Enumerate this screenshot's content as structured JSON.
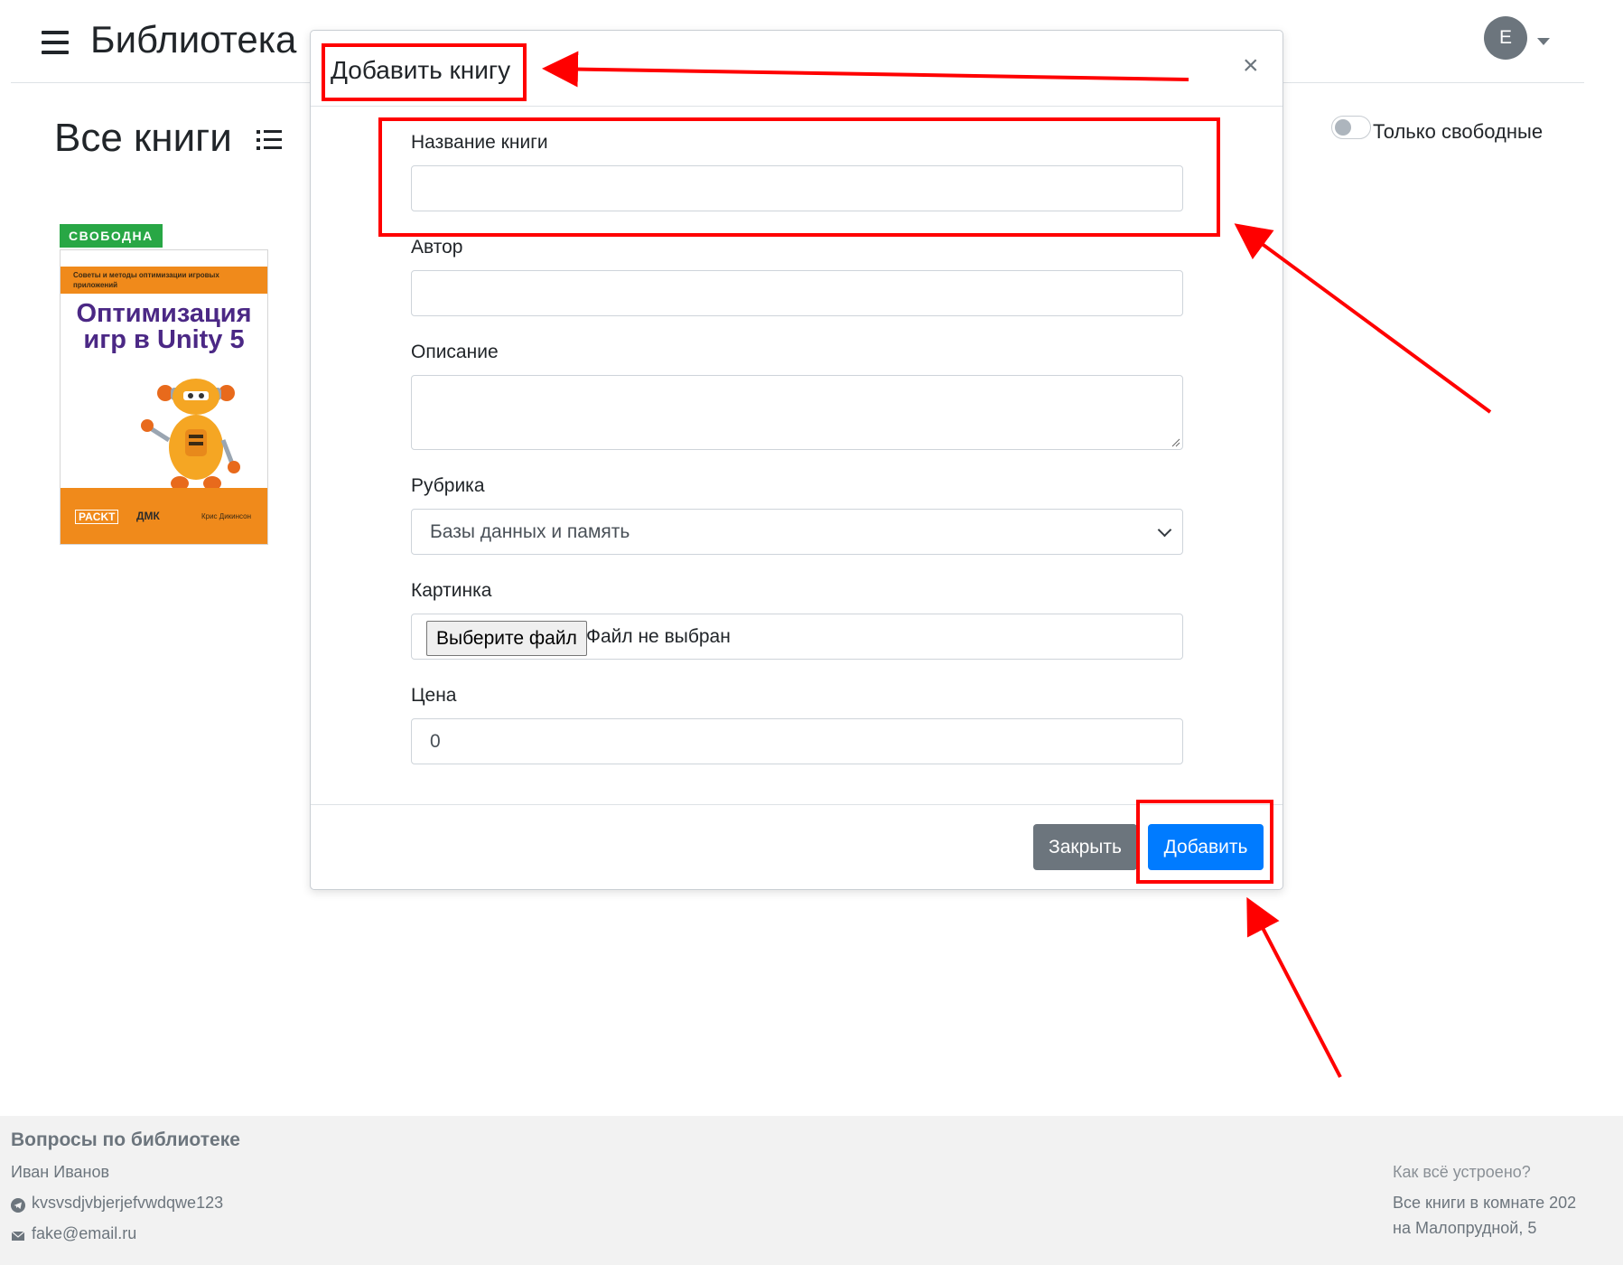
{
  "header": {
    "app_title": "Библиотека",
    "avatar_initial": "E"
  },
  "subheader": {
    "page_heading": "Все книги",
    "toggle_label": "Только свободные"
  },
  "book": {
    "badge": "СВОБОДНА",
    "cover_tagline": "Советы и методы оптимизации игровых приложений",
    "cover_title": "Оптимизация игр в Unity 5",
    "cover_publisher_1": "PACKT",
    "cover_publisher_2": "ДМК",
    "cover_author": "Крис Дикинсон"
  },
  "modal": {
    "title": "Добавить книгу",
    "close_symbol": "×",
    "fields": {
      "title_label": "Название книги",
      "title_value": "",
      "author_label": "Автор",
      "author_value": "",
      "description_label": "Описание",
      "description_value": "",
      "category_label": "Рубрика",
      "category_value": "Базы данных и память",
      "image_label": "Картинка",
      "image_button": "Выберите файл",
      "image_status": "Файл не выбран",
      "price_label": "Цена",
      "price_value": "0"
    },
    "buttons": {
      "close": "Закрыть",
      "add": "Добавить"
    }
  },
  "footer": {
    "heading": "Вопросы по библиотеке",
    "contact_name": "Иван Иванов",
    "telegram": "kvsvsdjvbjerjefvwdqwe123",
    "email": "fake@email.ru",
    "how_it_works": "Как всё устроено?",
    "location_line1": "Все книги в комнате 202",
    "location_line2": "на Малопрудной, 5"
  },
  "colors": {
    "primary": "#007bff",
    "secondary": "#6c757d",
    "success": "#28a745",
    "annotation": "#ff0000"
  }
}
